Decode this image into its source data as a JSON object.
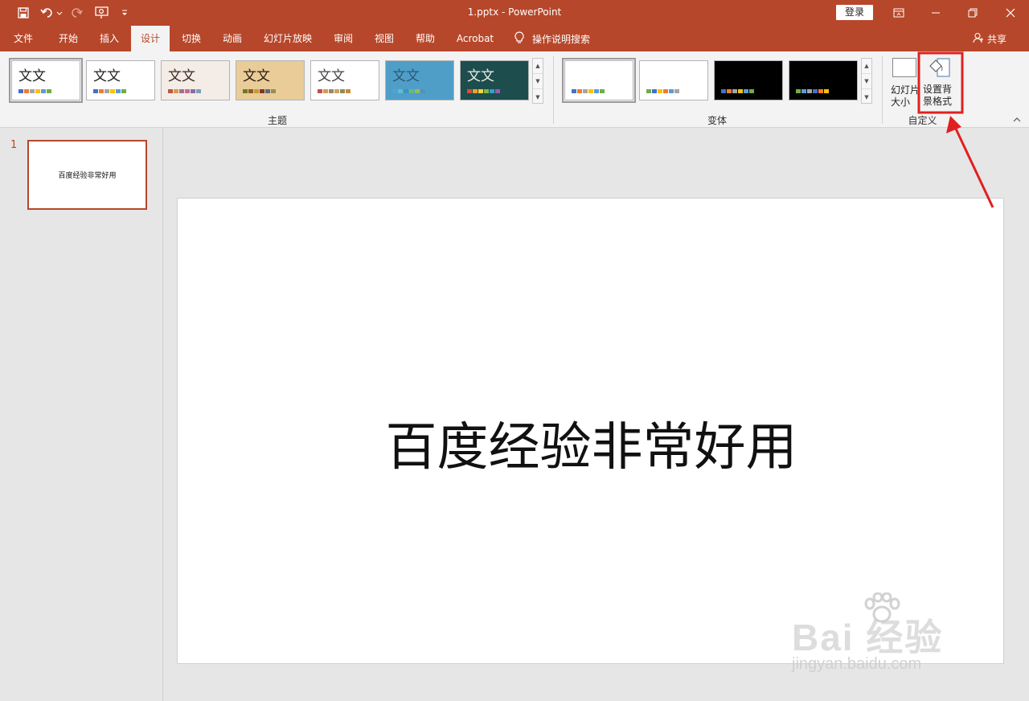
{
  "titlebar": {
    "title": "1.pptx  -  PowerPoint",
    "login": "登录",
    "icons": [
      "save-icon",
      "undo-icon",
      "redo-icon",
      "start-from-beginning-icon",
      "customize-qat-icon"
    ]
  },
  "tabs": [
    {
      "label": "文件"
    },
    {
      "label": "开始"
    },
    {
      "label": "插入"
    },
    {
      "label": "设计",
      "active": true
    },
    {
      "label": "切换"
    },
    {
      "label": "动画"
    },
    {
      "label": "幻灯片放映"
    },
    {
      "label": "审阅"
    },
    {
      "label": "视图"
    },
    {
      "label": "帮助"
    },
    {
      "label": "Acrobat"
    }
  ],
  "tell_me": "操作说明搜索",
  "share": "共享",
  "ribbon": {
    "themes_group": "主题",
    "variants_group": "变体",
    "customize_group": "自定义",
    "theme_sample": "文文",
    "slide_size": "幻灯片\n大小",
    "format_background": "设置背\n景格式"
  },
  "themes": [
    {
      "bg": "#ffffff",
      "text": "#222222",
      "swatches": [
        "#4472c4",
        "#ed7d31",
        "#a5a5a5",
        "#ffc000",
        "#5b9bd5",
        "#70ad47"
      ],
      "selected": true
    },
    {
      "bg": "#ffffff",
      "text": "#222222",
      "swatches": [
        "#4472c4",
        "#ed7d31",
        "#a5a5a5",
        "#ffc000",
        "#5b9bd5",
        "#70ad47"
      ]
    },
    {
      "bg": "#f4ece6",
      "text": "#3a2a20",
      "swatches": [
        "#b85a3e",
        "#d59b55",
        "#a46e8e",
        "#cc6699",
        "#8b6b9e",
        "#7c9fb8"
      ]
    },
    {
      "bg": "#e9cc98",
      "text": "#2a1a10",
      "swatches": [
        "#6b7a2a",
        "#8c5a2a",
        "#c49a3a",
        "#7a3a2a",
        "#5a6a8a",
        "#9a8a5a"
      ]
    },
    {
      "bg": "#ffffff",
      "text": "#444444",
      "swatches": [
        "#c0504d",
        "#d99755",
        "#9f8467",
        "#c9a36b",
        "#8c8c5a",
        "#c98a3a"
      ]
    },
    {
      "bg": "#4f9ec8",
      "text": "#2a5a78",
      "swatches": [
        "#4da3d4",
        "#5fbcd3",
        "#3d93bf",
        "#6fb57b",
        "#8fbf5a",
        "#5a8fb5"
      ]
    },
    {
      "bg": "#1e4d4d",
      "text": "#e6f0ea",
      "swatches": [
        "#e04a3a",
        "#f0a030",
        "#f7d140",
        "#7ab84a",
        "#3a9ad0",
        "#9a5ab0"
      ]
    }
  ],
  "variants": [
    {
      "bg": "#ffffff",
      "swatches": [
        "#4472c4",
        "#ed7d31",
        "#a5a5a5",
        "#ffc000",
        "#5b9bd5",
        "#70ad47"
      ],
      "selected": true
    },
    {
      "bg": "#ffffff",
      "swatches": [
        "#70ad47",
        "#4472c4",
        "#ffc000",
        "#ed7d31",
        "#5b9bd5",
        "#a5a5a5"
      ]
    },
    {
      "bg": "#000000",
      "swatches": [
        "#4472c4",
        "#ed7d31",
        "#a5a5a5",
        "#ffc000",
        "#5b9bd5",
        "#70ad47"
      ]
    },
    {
      "bg": "#000000",
      "swatches": [
        "#70ad47",
        "#5b9bd5",
        "#a5a5a5",
        "#4472c4",
        "#ed7d31",
        "#ffc000"
      ]
    }
  ],
  "slides": [
    {
      "number": "1",
      "text": "百度经验非常好用"
    }
  ],
  "slide": {
    "title": "百度经验非常好用"
  },
  "watermark": {
    "brand": "Bai  经验",
    "url": "jingyan.baidu.com"
  },
  "colors": {
    "accent": "#b7472a",
    "highlight": "#e02020"
  }
}
